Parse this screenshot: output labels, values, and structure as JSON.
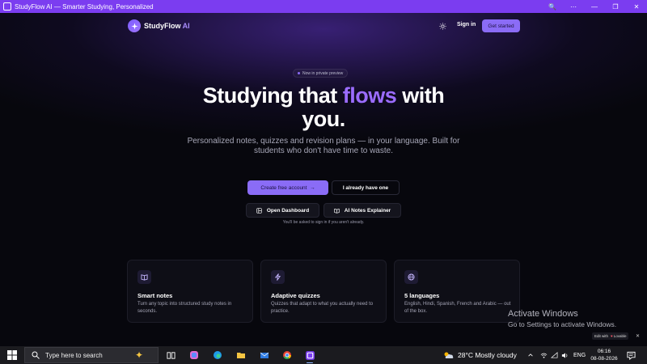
{
  "window": {
    "title": "StudyFlow AI — Smarter Studying, Personalized",
    "controls": {
      "zoom": "🔍",
      "menu": "⋯",
      "minimize": "—",
      "restore": "❐",
      "close": "✕"
    }
  },
  "nav": {
    "brand_name": "StudyFlow",
    "brand_suffix": "AI",
    "signin_label": "Sign in",
    "get_started_label": "Get started"
  },
  "hero": {
    "badge": "Now in private preview",
    "title_part1": "Studying that ",
    "title_highlight": "flows",
    "title_part2": " with",
    "title_line2": "you.",
    "subtitle": "Personalized notes, quizzes and revision plans — in your language. Built for students who don't have time to waste.",
    "primary_cta": "Create free account",
    "primary_cta_arrow": "→",
    "secondary_cta": "I already have one",
    "dashboard_btn": "Open Dashboard",
    "notes_btn": "AI Notes Explainer",
    "signin_note": "You'll be asked to sign in if you aren't already."
  },
  "features": [
    {
      "title": "Smart notes",
      "description": "Turn any topic into structured study notes in seconds.",
      "icon": "book-icon"
    },
    {
      "title": "Adaptive quizzes",
      "description": "Quizzes that adapt to what you actually need to practice.",
      "icon": "bolt-icon"
    },
    {
      "title": "5 languages",
      "description": "English, Hindi, Spanish, French and Arabic — out of the box.",
      "icon": "globe-icon"
    }
  ],
  "watermark": {
    "line1": "Activate Windows",
    "line2": "Go to Settings to activate Windows."
  },
  "lovable_badge": {
    "prefix": "Edit with",
    "name": "Lovable",
    "close": "✕"
  },
  "taskbar": {
    "search_placeholder": "Type here to search",
    "weather": "28°C  Mostly cloudy",
    "language": "ENG",
    "time": "06:16",
    "date": "08-08-2026"
  },
  "colors": {
    "accent": "#8b6cf6",
    "highlight": "#9b6cff",
    "titlebar": "#7b3df0"
  }
}
